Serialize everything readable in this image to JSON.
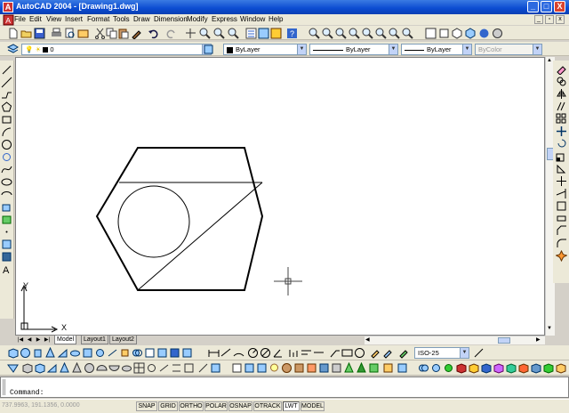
{
  "window": {
    "title": "AutoCAD 2004 - [Drawing1.dwg]",
    "minimize": "_",
    "maximize": "□",
    "close": "X"
  },
  "menu": [
    "File",
    "Edit",
    "View",
    "Insert",
    "Format",
    "Tools",
    "Draw",
    "Dimension",
    "Modify",
    "Express",
    "Window",
    "Help"
  ],
  "layer": {
    "name": "0"
  },
  "properties": {
    "color": "ByLayer",
    "linetype": "ByLayer",
    "lineweight": "ByLayer",
    "plotstyle": "ByColor"
  },
  "dimstyle": {
    "value": "ISO-25"
  },
  "layout_tabs": [
    "Model",
    "Layout1",
    "Layout2"
  ],
  "ucs": {
    "x_label": "X",
    "y_label": "Y"
  },
  "command": {
    "prompt": "Command:"
  },
  "status": {
    "coords": "737.9963, 191.1356, 0.0000",
    "toggles": [
      "SNAP",
      "GRID",
      "ORTHO",
      "POLAR",
      "OSNAP",
      "OTRACK",
      "LWT",
      "MODEL"
    ],
    "active": [
      "LWT"
    ]
  },
  "colors": {
    "title_blue": "#0b4bd1",
    "canvas": "#ffffff",
    "toolbar": "#ece9d8"
  }
}
